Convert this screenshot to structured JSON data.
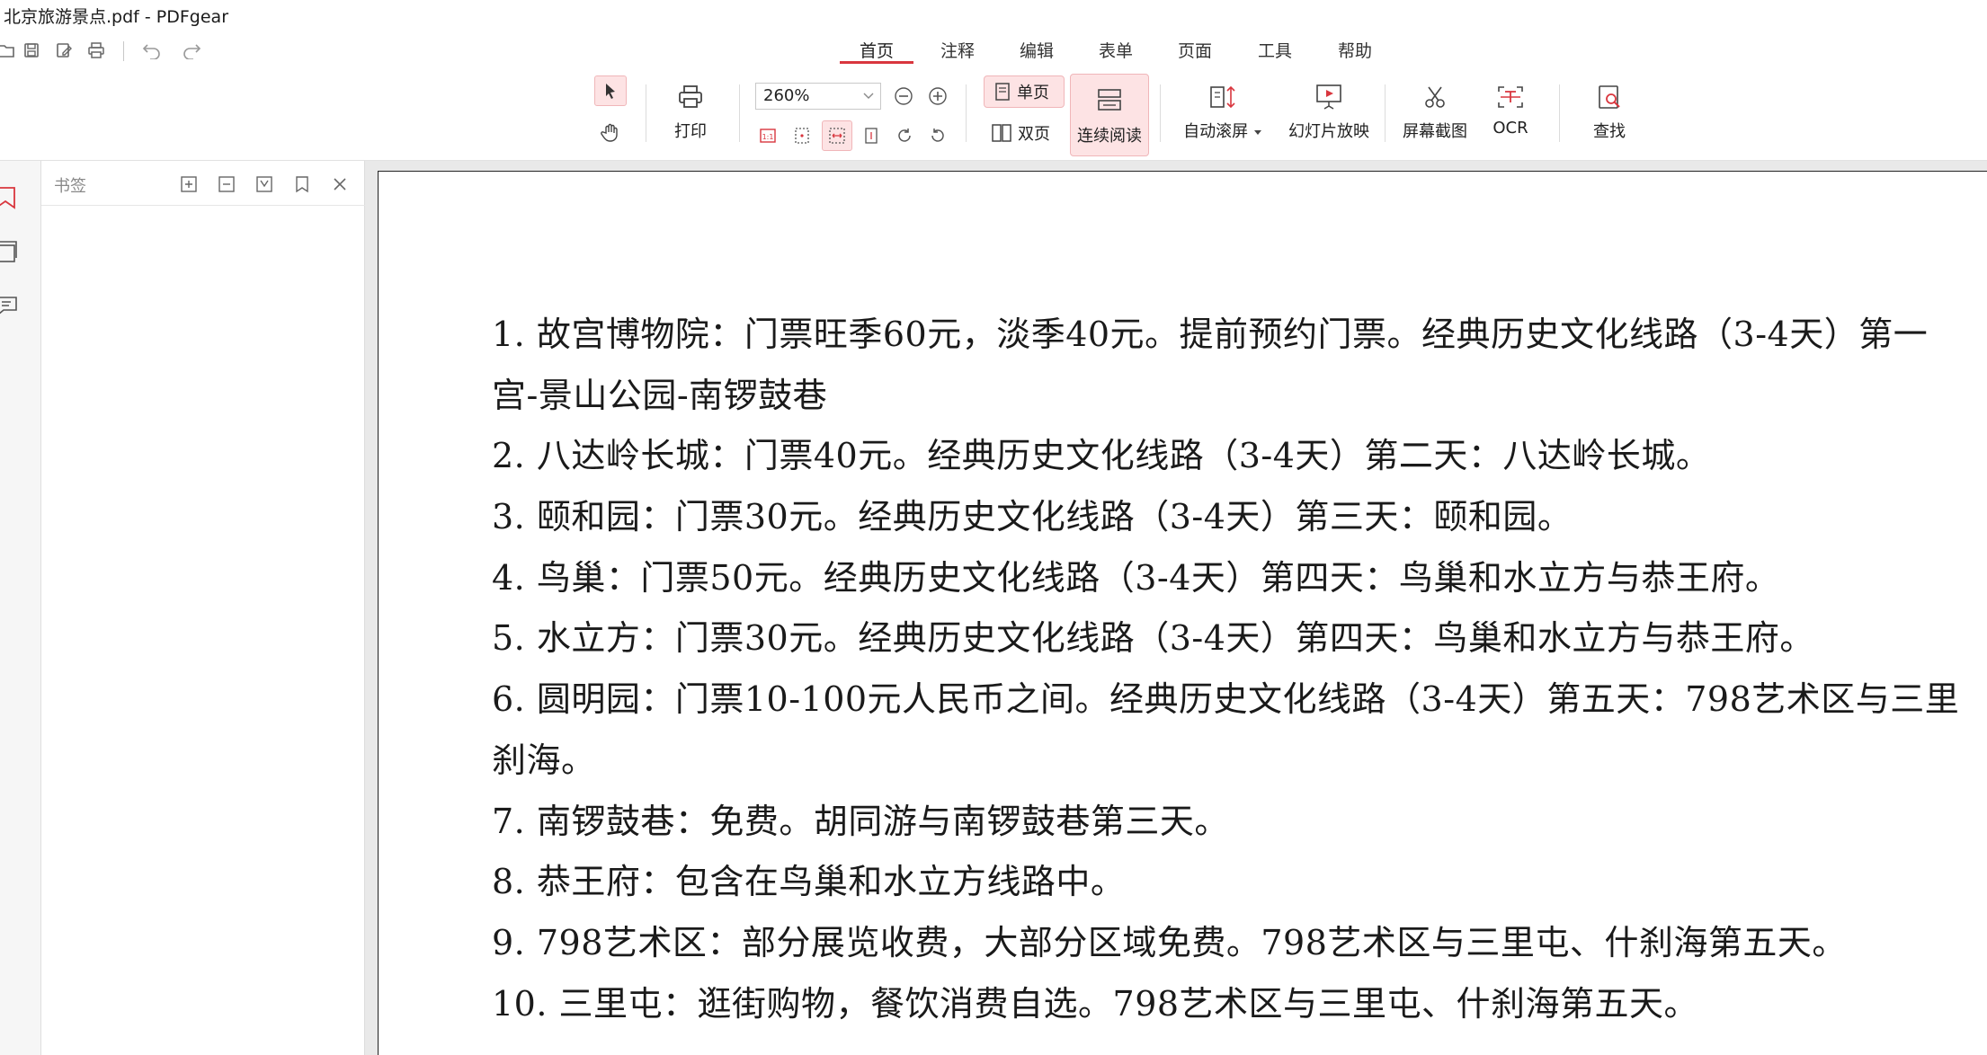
{
  "window": {
    "title": "北京旅游景点.pdf - PDFgear"
  },
  "quick_access": {
    "icons": [
      "open-icon",
      "save-icon",
      "save-as-icon",
      "print-icon",
      "undo-icon",
      "redo-icon"
    ]
  },
  "menu": {
    "tabs": [
      {
        "label": "首页",
        "active": true
      },
      {
        "label": "注释"
      },
      {
        "label": "编辑"
      },
      {
        "label": "表单"
      },
      {
        "label": "页面"
      },
      {
        "label": "工具"
      },
      {
        "label": "帮助"
      }
    ]
  },
  "ribbon": {
    "print_label": "打印",
    "zoom_value": "260%",
    "single_page_label": "单页",
    "double_page_label": "双页",
    "continuous_label": "连续阅读",
    "auto_scroll_label": "自动滚屏",
    "slideshow_label": "幻灯片放映",
    "screenshot_label": "屏幕截图",
    "ocr_label": "OCR",
    "find_label": "查找"
  },
  "sidebar": {
    "panel_title": "书签"
  },
  "document": {
    "lines": [
      "1. 故宫博物院：门票旺季60元，淡季40元。提前预约门票。经典历史文化线路（3-4天）第一",
      "宫-景山公园-南锣鼓巷",
      "2. 八达岭长城：门票40元。经典历史文化线路（3-4天）第二天：八达岭长城。",
      "3. 颐和园：门票30元。经典历史文化线路（3-4天）第三天：颐和园。",
      "4. 鸟巢：门票50元。经典历史文化线路（3-4天）第四天：鸟巢和水立方与恭王府。",
      "5. 水立方：门票30元。经典历史文化线路（3-4天）第四天：鸟巢和水立方与恭王府。",
      "6. 圆明园：门票10-100元人民币之间。经典历史文化线路（3-4天）第五天：798艺术区与三里",
      "刹海。",
      "7. 南锣鼓巷：免费。胡同游与南锣鼓巷第三天。",
      "8. 恭王府：包含在鸟巢和水立方线路中。",
      "9. 798艺术区：部分展览收费，大部分区域免费。798艺术区与三里屯、什刹海第五天。",
      "10. 三里屯：逛街购物，餐饮消费自选。798艺术区与三里屯、什刹海第五天。"
    ]
  },
  "colors": {
    "accent": "#d9363e",
    "active_bg": "#fde3e4"
  }
}
